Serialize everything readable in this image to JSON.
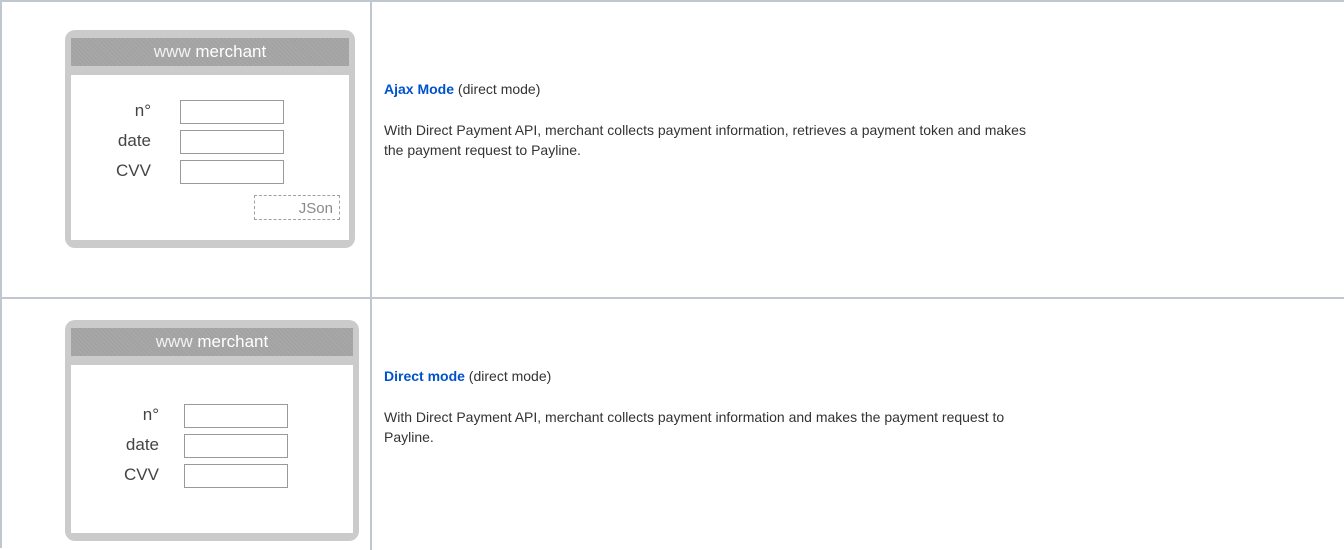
{
  "rows": [
    {
      "mock": {
        "header_prefix": "www",
        "header_brand": "merchant",
        "fields": [
          "n°",
          "date",
          "CVV"
        ],
        "json_label": "JSon"
      },
      "mode_link": "Ajax Mode",
      "mode_suffix": " (direct mode)",
      "description_line1": "With Direct Payment API, merchant collects payment information, retrieves a payment token and makes",
      "description_line2": "the payment request to Payline."
    },
    {
      "mock": {
        "header_prefix": "www",
        "header_brand": "merchant",
        "fields": [
          "n°",
          "date",
          "CVV"
        ]
      },
      "mode_link": "Direct mode",
      "mode_suffix": " (direct mode)",
      "description_line1": "With Direct Payment API, merchant collects payment information and makes the payment request to",
      "description_line2": "Payline."
    }
  ]
}
